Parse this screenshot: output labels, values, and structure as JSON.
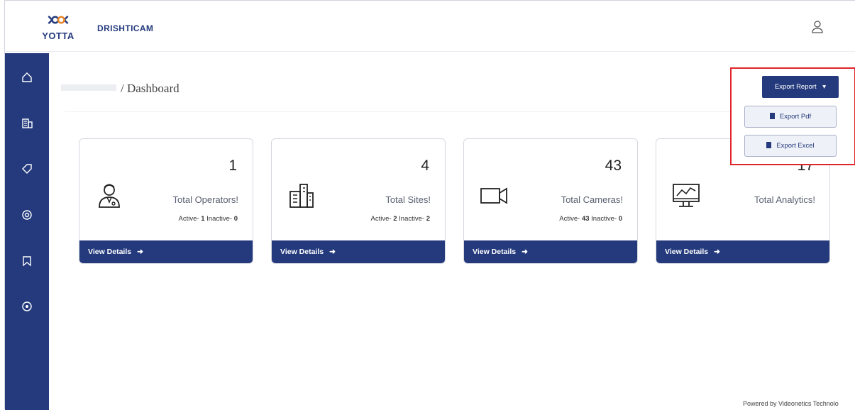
{
  "header": {
    "logo_text": "YOTTA",
    "app_name": "DRISHTICAM",
    "user_icon": "user-icon"
  },
  "sidebar": {
    "items": [
      {
        "icon": "home-icon"
      },
      {
        "icon": "building-icon"
      },
      {
        "icon": "tag-icon"
      },
      {
        "icon": "support-icon"
      },
      {
        "icon": "bookmark-icon"
      },
      {
        "icon": "settings-icon"
      }
    ]
  },
  "breadcrumb": {
    "current": "/ Dashboard"
  },
  "export": {
    "button_label": "Export Report",
    "items": [
      "Export Pdf",
      "Export Excel"
    ]
  },
  "cards": [
    {
      "count": "1",
      "label": "Total Operators!",
      "active_label": "Active-",
      "active": "1",
      "inactive_label": "Inactive-",
      "inactive": "0",
      "footer": "View Details",
      "icon": "operator-icon"
    },
    {
      "count": "4",
      "label": "Total Sites!",
      "active_label": "Active-",
      "active": "2",
      "inactive_label": "Inactive-",
      "inactive": "2",
      "footer": "View Details",
      "icon": "building-icon"
    },
    {
      "count": "43",
      "label": "Total Cameras!",
      "active_label": "Active-",
      "active": "43",
      "inactive_label": "Inactive-",
      "inactive": "0",
      "footer": "View Details",
      "icon": "video-camera-icon"
    },
    {
      "count": "17",
      "label": "Total Analytics!",
      "footer": "View Details",
      "icon": "analytics-monitor-icon"
    }
  ],
  "footer": {
    "powered_by": "Powered by Videonetics Technolo"
  },
  "colors": {
    "primary": "#243a7d",
    "highlight_border": "#e0242b"
  }
}
